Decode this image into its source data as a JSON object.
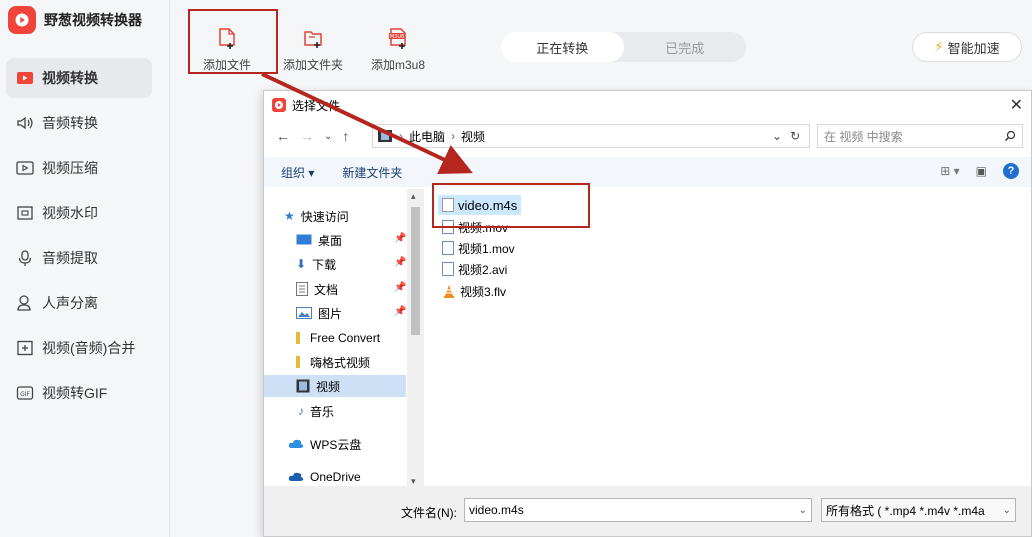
{
  "app": {
    "name": "野葱视频转换器"
  },
  "sidebar": {
    "items": [
      {
        "label": "视频转换",
        "icon": "video-convert-icon",
        "active": true
      },
      {
        "label": "音频转换",
        "icon": "audio-convert-icon"
      },
      {
        "label": "视频压缩",
        "icon": "video-compress-icon"
      },
      {
        "label": "视频水印",
        "icon": "watermark-icon"
      },
      {
        "label": "音频提取",
        "icon": "audio-extract-icon"
      },
      {
        "label": "人声分离",
        "icon": "vocal-separate-icon"
      },
      {
        "label": "视频(音频)合并",
        "icon": "merge-icon"
      },
      {
        "label": "视频转GIF",
        "icon": "gif-icon"
      }
    ]
  },
  "toolbar": {
    "add_file": "添加文件",
    "add_folder": "添加文件夹",
    "add_m3u8": "添加m3u8",
    "m3u8_badge": "M3U8"
  },
  "tabs": {
    "converting": "正在转换",
    "completed": "已完成"
  },
  "accel_button": "智能加速",
  "dialog": {
    "title": "选择文件",
    "breadcrumb": [
      "此电脑",
      "视频"
    ],
    "search_placeholder": "在 视频 中搜索",
    "commands": {
      "organize": "组织 ▾",
      "new_folder": "新建文件夹"
    },
    "tree": [
      {
        "label": "快速访问",
        "icon": "star-icon"
      },
      {
        "label": "桌面",
        "icon": "desktop-icon",
        "pinned": true
      },
      {
        "label": "下载",
        "icon": "download-icon",
        "pinned": true
      },
      {
        "label": "文档",
        "icon": "document-icon",
        "pinned": true
      },
      {
        "label": "图片",
        "icon": "picture-icon",
        "pinned": true
      },
      {
        "label": "Free Convert",
        "icon": "folder-icon"
      },
      {
        "label": "嗨格式视频",
        "icon": "folder-icon"
      },
      {
        "label": "视频",
        "icon": "video-folder-icon",
        "selected": true
      },
      {
        "label": "音乐",
        "icon": "music-icon"
      },
      {
        "label": "WPS云盘",
        "icon": "cloud-icon"
      },
      {
        "label": "OneDrive",
        "icon": "onedrive-icon"
      }
    ],
    "files": [
      {
        "name": "video.m4s",
        "selected": true
      },
      {
        "name": "视频.mov"
      },
      {
        "name": "视频1.mov"
      },
      {
        "name": "视频2.avi"
      },
      {
        "name": "视频3.flv"
      }
    ],
    "filename_label": "文件名(N):",
    "filename_value": "video.m4s",
    "filetype_value": "所有格式 ( *.mp4 *.m4v *.m4a"
  },
  "colors": {
    "accent": "#f0433a",
    "highlight_box": "#b5271e",
    "selection": "#cce8ff"
  }
}
